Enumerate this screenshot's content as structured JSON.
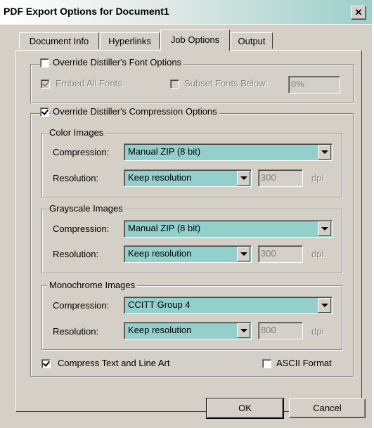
{
  "window": {
    "title": "PDF Export Options for Document1",
    "close_glyph": "✕"
  },
  "tabs": [
    {
      "label": "Document Info"
    },
    {
      "label": "Hyperlinks"
    },
    {
      "label": "Job Options"
    },
    {
      "label": "Output"
    }
  ],
  "font_options": {
    "override_label": "Override Distiller's Font Options",
    "embed_label": "Embed All Fonts",
    "subset_label": "Subset Fonts Below:",
    "subset_value": "0%"
  },
  "compression_options": {
    "override_label": "Override Distiller's Compression Options",
    "color": {
      "legend": "Color Images",
      "compression_label": "Compression:",
      "compression_value": "Manual ZIP (8 bit)",
      "resolution_label": "Resolution:",
      "resolution_value": "Keep resolution",
      "dpi_value": "300",
      "dpi_unit": "dpi"
    },
    "grayscale": {
      "legend": "Grayscale Images",
      "compression_label": "Compression:",
      "compression_value": "Manual ZIP (8 bit)",
      "resolution_label": "Resolution:",
      "resolution_value": "Keep resolution",
      "dpi_value": "300",
      "dpi_unit": "dpi"
    },
    "monochrome": {
      "legend": "Monochrome Images",
      "compression_label": "Compression:",
      "compression_value": "CCITT Group 4",
      "resolution_label": "Resolution:",
      "resolution_value": "Keep resolution",
      "dpi_value": "800",
      "dpi_unit": "dpi"
    },
    "compress_text_label": "Compress Text and Line Art",
    "ascii_label": "ASCII Format"
  },
  "buttons": {
    "ok": "OK",
    "cancel": "Cancel"
  },
  "colors": {
    "accent": "#93cfcb",
    "face": "#d4d0c8"
  }
}
